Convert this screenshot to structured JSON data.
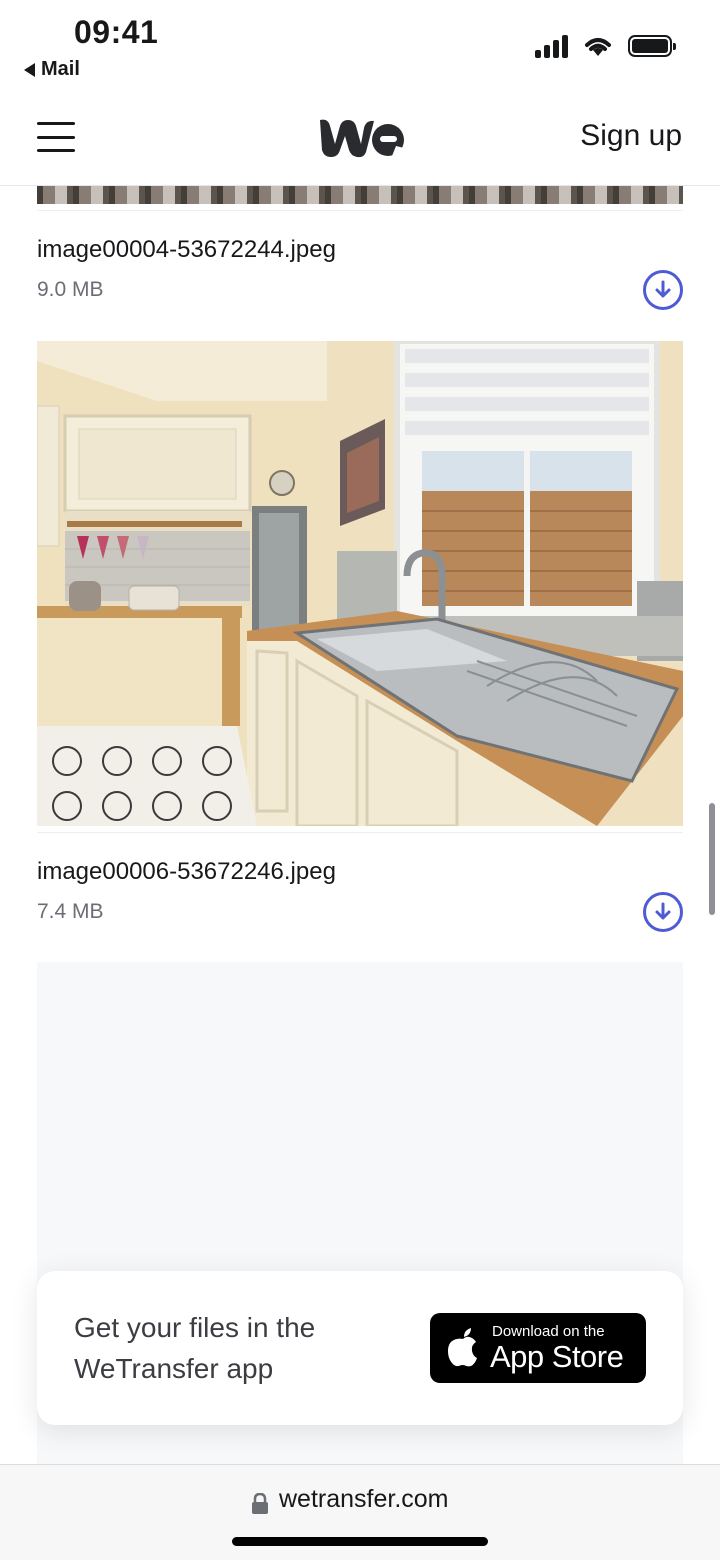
{
  "status": {
    "time": "09:41",
    "back_app": "Mail"
  },
  "header": {
    "signup_label": "Sign up",
    "logo": "we-logo"
  },
  "files": [
    {
      "name": "image00004-53672244.jpeg",
      "size": "9.0 MB"
    },
    {
      "name": "image00006-53672246.jpeg",
      "size": "7.4 MB"
    }
  ],
  "promo": {
    "text_line1": "Get your files in the",
    "text_line2": "WeTransfer app",
    "badge_small": "Download on the",
    "badge_big": "App Store"
  },
  "browser": {
    "url": "wetransfer.com"
  },
  "colors": {
    "accent": "#4f5bd5",
    "text": "#17181a",
    "muted": "#6b6e75",
    "badge_bg": "#000000"
  }
}
